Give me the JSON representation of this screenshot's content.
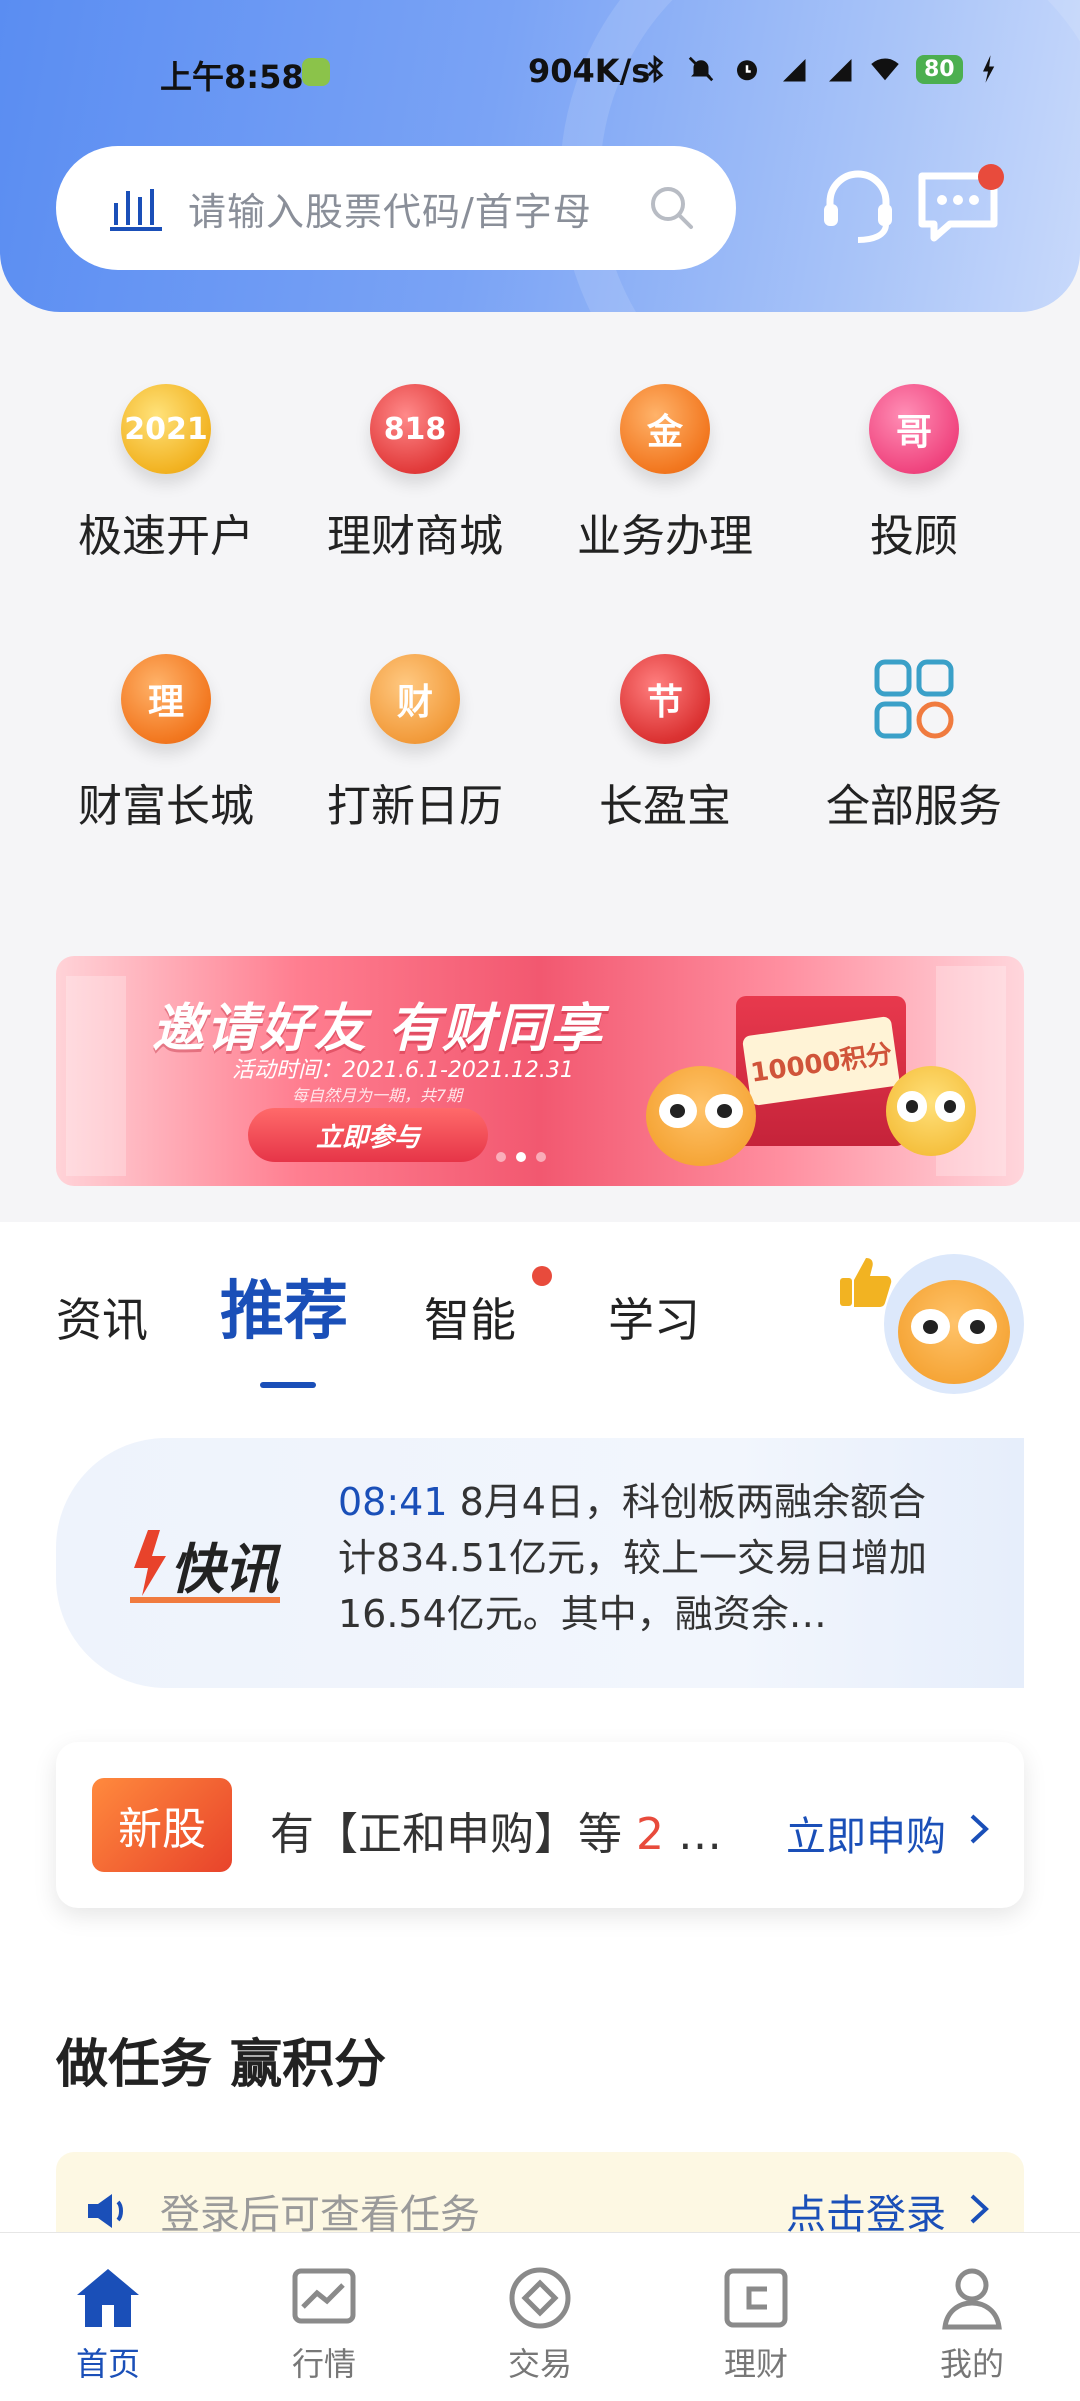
{
  "status_bar": {
    "time": "上午8:58",
    "speed": "904K/s",
    "battery": "80"
  },
  "search": {
    "placeholder": "请输入股票代码/首字母"
  },
  "quick_services": [
    {
      "label": "极速开户",
      "icon_text": "2021",
      "icon": "2021-coin-icon"
    },
    {
      "label": "理财商城",
      "icon_text": "818",
      "icon": "818-coin-icon"
    },
    {
      "label": "业务办理",
      "icon_text": "金",
      "icon": "gold-coin-icon"
    },
    {
      "label": "投顾",
      "icon_text": "哥",
      "icon": "advisor-coin-icon"
    },
    {
      "label": "财富长城",
      "icon_text": "理",
      "icon": "wealth-coin-icon"
    },
    {
      "label": "打新日历",
      "icon_text": "财",
      "icon": "ipo-calendar-coin-icon"
    },
    {
      "label": "长盈宝",
      "icon_text": "节",
      "icon": "changyingbao-coin-icon"
    },
    {
      "label": "全部服务",
      "icon_text": "",
      "icon": "all-services-grid-icon"
    }
  ],
  "banner": {
    "title": "邀请好友 有财同享",
    "date": "活动时间：2021.6.1-2021.12.31",
    "sub": "每自然月为一期，共7期",
    "button": "立即参与",
    "coupon": "10000积分"
  },
  "tabs": {
    "items": [
      "资讯",
      "推荐",
      "智能",
      "学习"
    ],
    "active": "推荐"
  },
  "flash_news": {
    "logo_text": "快讯",
    "time": "08:41",
    "text": " 8月4日，科创板两融余额合计834.51亿元，较上一交易日增加16.54亿元。其中，融资余…"
  },
  "ipo_notice": {
    "badge": "新股",
    "prefix": "有【正和申购】等 ",
    "count": "2",
    "suffix": " …",
    "link": "立即申购"
  },
  "tasks": {
    "title": "做任务 赢积分",
    "notice": "登录后可查看任务",
    "login": "点击登录"
  },
  "bottom_nav": [
    {
      "label": "首页",
      "icon": "home-icon",
      "active": true
    },
    {
      "label": "行情",
      "icon": "market-chart-icon",
      "active": false
    },
    {
      "label": "交易",
      "icon": "trade-icon",
      "active": false
    },
    {
      "label": "理财",
      "icon": "wealth-icon",
      "active": false
    },
    {
      "label": "我的",
      "icon": "profile-icon",
      "active": false
    }
  ],
  "colors": {
    "accent": "#1a4fb8",
    "alert": "#e84b3c"
  }
}
